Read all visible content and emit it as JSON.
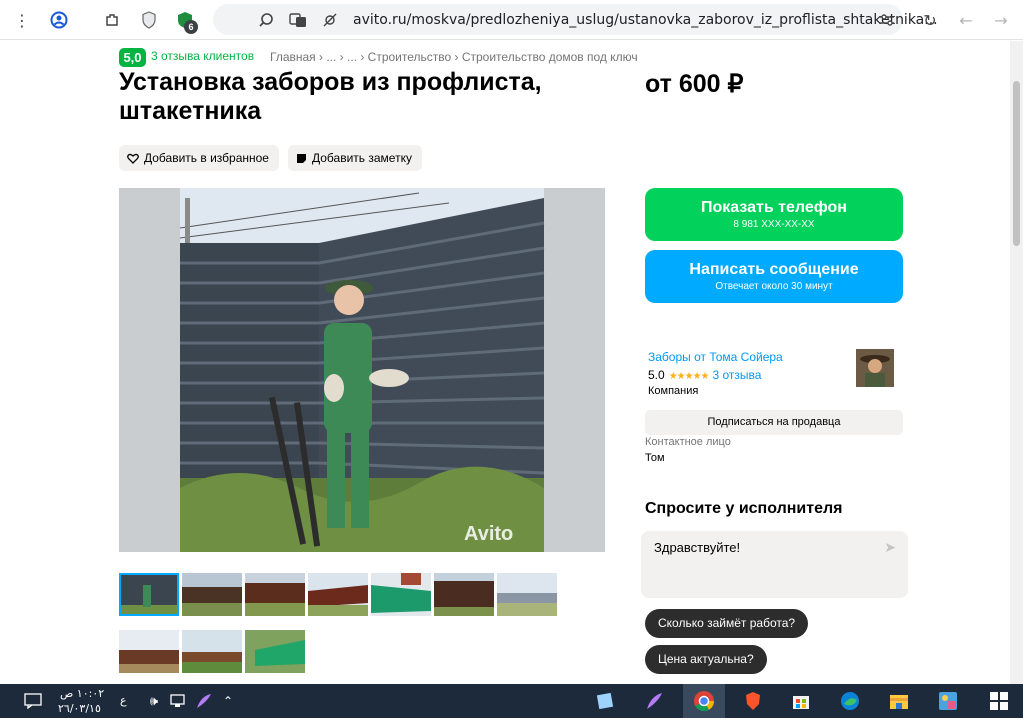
{
  "browser": {
    "url": "avito.ru/moskva/predlozheniya_uslug/ustanovka_zaborov_iz_proflista_shtaketnika...",
    "extension_badge": "6"
  },
  "header": {
    "rating": "5,0",
    "reviews_link": "3 отзыва клиентов",
    "breadcrumb": "Главная › ... › ... › Строительство › Строительство домов под ключ"
  },
  "listing": {
    "title": "Установка заборов из профлиста, штакетника",
    "price": "от 600 ₽",
    "favorite_label": "Добавить в избранное",
    "note_label": "Добавить заметку",
    "watermark": "Avito"
  },
  "contact": {
    "phone_label": "Показать телефон",
    "phone_number": "8 981 XXX-XX-XX",
    "message_label": "Написать сообщение",
    "message_sub": "Отвечает около 30 минут"
  },
  "seller": {
    "name": "Заборы от Тома Сойера",
    "rating": "5.0",
    "stars": "★★★★★",
    "reviews": "3 отзыва",
    "type": "Компания",
    "subscribe_label": "Подписаться на продавца",
    "contact_label": "Контактное лицо",
    "contact_name": "Том"
  },
  "ask": {
    "title": "Спросите у исполнителя",
    "message": "Здравствуйте!",
    "chips": [
      "Сколько займёт работа?",
      "Цена актуальна?"
    ]
  },
  "taskbar": {
    "time": "١٠:٠٢ ص",
    "date": "٢٦/٠٣/١٥",
    "lang": "ع"
  },
  "colors": {
    "green": "#02d15c",
    "blue": "#00aaff",
    "badge_green": "#04b442",
    "link_blue": "#0099f7"
  }
}
